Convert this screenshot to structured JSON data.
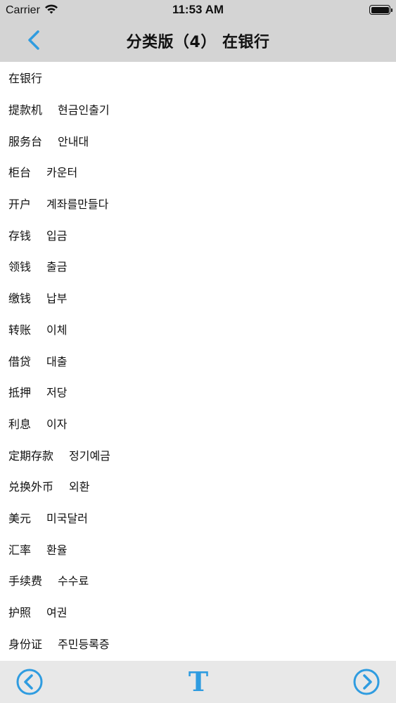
{
  "status_bar": {
    "carrier": "Carrier",
    "time": "11:53 AM"
  },
  "nav": {
    "title": "分类版（4） 在银行"
  },
  "colors": {
    "accent": "#2f9ce0",
    "bar_bg": "#d4d4d4",
    "bottom_bg": "#e8e8e8"
  },
  "icons": {
    "back": "chevron-left-icon",
    "prev": "circle-chevron-left-icon",
    "next": "circle-chevron-right-icon",
    "font": "text-size-icon"
  },
  "bottom_bar": {
    "font_button_label": "T"
  },
  "words": [
    {
      "zh": "在银行",
      "ko": ""
    },
    {
      "zh": "提款机",
      "ko": "현금인출기"
    },
    {
      "zh": "服务台",
      "ko": "안내대"
    },
    {
      "zh": "柜台",
      "ko": "카운터"
    },
    {
      "zh": "开户",
      "ko": "계좌를만들다"
    },
    {
      "zh": "存钱",
      "ko": "입금"
    },
    {
      "zh": "领钱",
      "ko": "출금"
    },
    {
      "zh": "缴钱",
      "ko": "납부"
    },
    {
      "zh": "转账",
      "ko": "이체"
    },
    {
      "zh": "借贷",
      "ko": "대출"
    },
    {
      "zh": "抵押",
      "ko": "저당"
    },
    {
      "zh": "利息",
      "ko": "이자"
    },
    {
      "zh": "定期存款",
      "ko": "정기예금"
    },
    {
      "zh": "兑换外币",
      "ko": "외환"
    },
    {
      "zh": "美元",
      "ko": "미국달러"
    },
    {
      "zh": "汇率",
      "ko": "환율"
    },
    {
      "zh": "手续费",
      "ko": "수수료"
    },
    {
      "zh": "护照",
      "ko": "여권"
    },
    {
      "zh": "身份证",
      "ko": "주민등록증"
    }
  ]
}
